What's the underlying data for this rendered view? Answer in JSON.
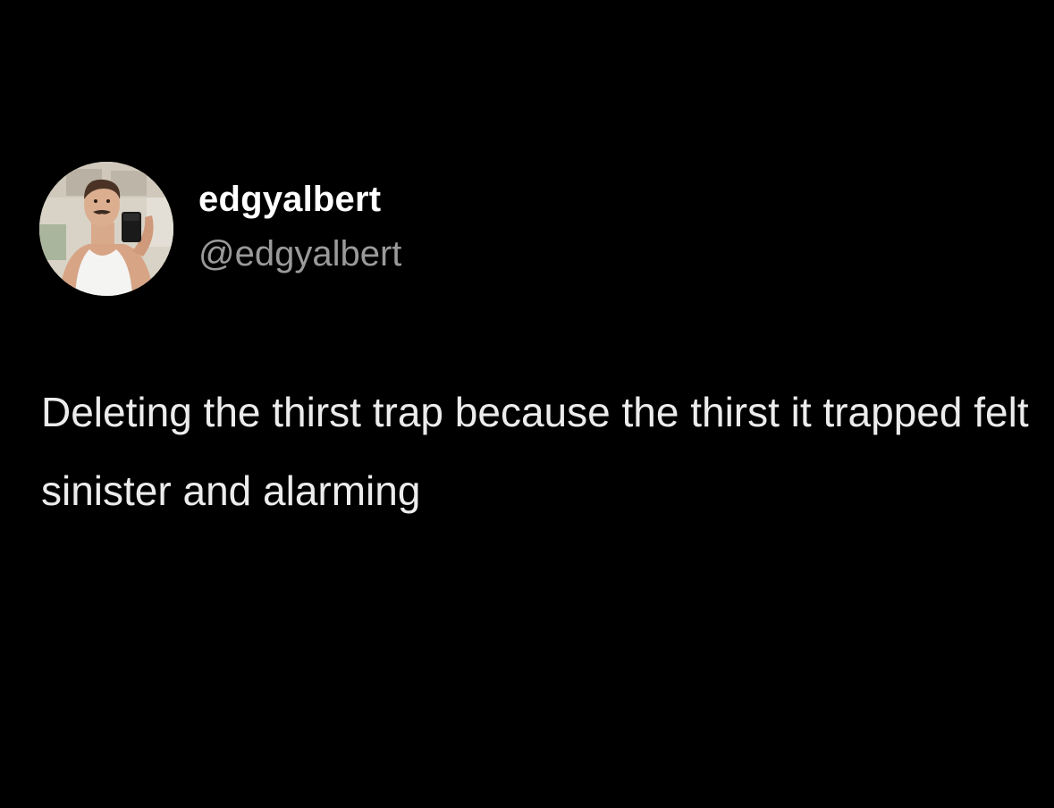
{
  "author": {
    "display_name": "edgyalbert",
    "handle": "@edgyalbert",
    "avatar_icon": "profile-photo-avatar"
  },
  "tweet": {
    "text": "Deleting the thirst trap because the thirst it trapped felt sinister and alarming"
  },
  "colors": {
    "background": "#000000",
    "name": "#ffffff",
    "handle": "#9a9a9a",
    "body": "#ececec"
  }
}
